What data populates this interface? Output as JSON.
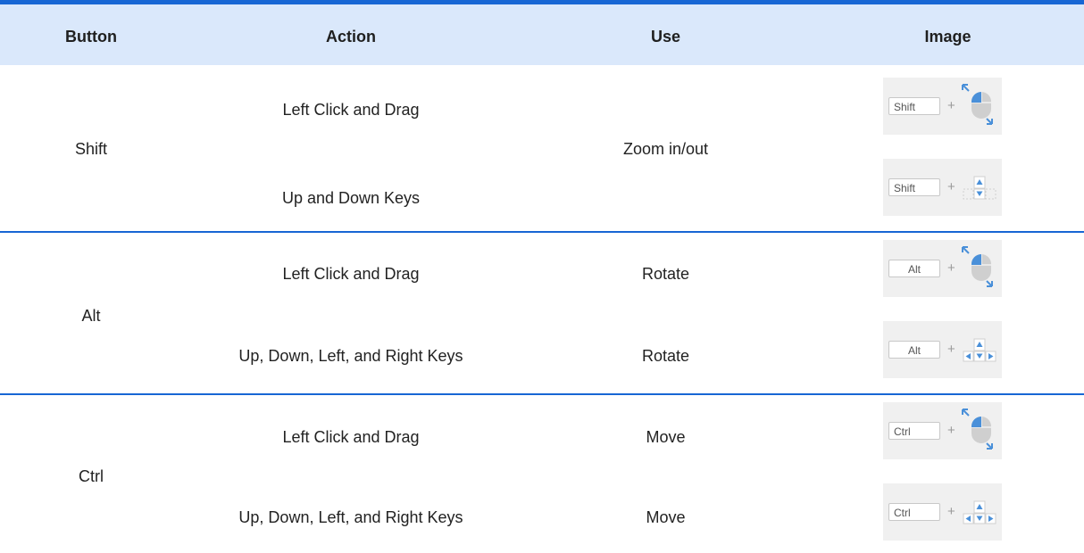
{
  "header": {
    "button": "Button",
    "action": "Action",
    "use": "Use",
    "image": "Image"
  },
  "groups": [
    {
      "button": "Shift",
      "use_shared": "Zoom in/out",
      "rows": [
        {
          "action": "Left Click and Drag",
          "use": "",
          "key": "Shift",
          "icon": "mouse-icon"
        },
        {
          "action": "Up and Down Keys",
          "use": "",
          "key": "Shift",
          "icon": "up-down-arrow-keys-icon"
        }
      ]
    },
    {
      "button": "Alt",
      "rows": [
        {
          "action": "Left Click and Drag",
          "use": "Rotate",
          "key": "Alt",
          "icon": "mouse-icon"
        },
        {
          "action": "Up, Down, Left, and Right Keys",
          "use": "Rotate",
          "key": "Alt",
          "icon": "arrow-keys-icon"
        }
      ]
    },
    {
      "button": "Ctrl",
      "rows": [
        {
          "action": "Left Click and Drag",
          "use": "Move",
          "key": "Ctrl",
          "icon": "mouse-icon"
        },
        {
          "action": "Up, Down, Left, and Right Keys",
          "use": "Move",
          "key": "Ctrl",
          "icon": "arrow-keys-icon"
        }
      ]
    }
  ],
  "plus_sign": "+",
  "colors": {
    "accent": "#1766d4",
    "header_bg": "#dae8fb",
    "image_bg": "#f0f0f0",
    "icon_blue": "#4a90d9"
  }
}
